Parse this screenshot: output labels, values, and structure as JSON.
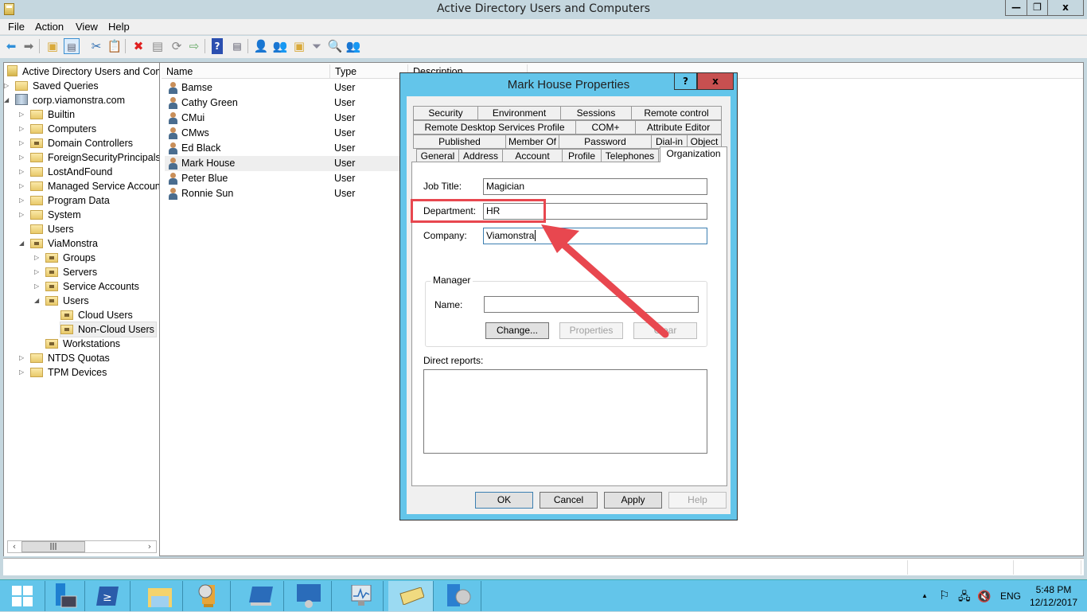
{
  "window": {
    "title": "Active Directory Users and Computers",
    "controls": {
      "minimize": "—",
      "restore": "❐",
      "close": "x"
    }
  },
  "menu": [
    "File",
    "Action",
    "View",
    "Help"
  ],
  "toolbar": {
    "buttons": [
      "back",
      "forward",
      "up-level",
      "show-hide-console-tree",
      "cut",
      "copy",
      "delete",
      "properties",
      "refresh",
      "export-list",
      "help",
      "show-action-pane",
      "new-user",
      "new-group",
      "new-ou",
      "filter",
      "find",
      "add-to-group"
    ]
  },
  "tree": {
    "root": "Active Directory Users and Com",
    "items": [
      {
        "label": "Saved Queries",
        "level": 1,
        "expander": "collapsed",
        "icon": "folder"
      },
      {
        "label": "corp.viamonstra.com",
        "level": 1,
        "expander": "expanded",
        "icon": "domain"
      },
      {
        "label": "Builtin",
        "level": 2,
        "expander": "collapsed",
        "icon": "folder"
      },
      {
        "label": "Computers",
        "level": 2,
        "expander": "collapsed",
        "icon": "folder"
      },
      {
        "label": "Domain Controllers",
        "level": 2,
        "expander": "collapsed",
        "icon": "ou"
      },
      {
        "label": "ForeignSecurityPrincipals",
        "level": 2,
        "expander": "collapsed",
        "icon": "folder"
      },
      {
        "label": "LostAndFound",
        "level": 2,
        "expander": "collapsed",
        "icon": "folder"
      },
      {
        "label": "Managed Service Accounts",
        "level": 2,
        "expander": "collapsed",
        "icon": "folder"
      },
      {
        "label": "Program Data",
        "level": 2,
        "expander": "collapsed",
        "icon": "folder"
      },
      {
        "label": "System",
        "level": 2,
        "expander": "collapsed",
        "icon": "folder"
      },
      {
        "label": "Users",
        "level": 2,
        "expander": "none",
        "icon": "folder"
      },
      {
        "label": "ViaMonstra",
        "level": 2,
        "expander": "expanded",
        "icon": "ou"
      },
      {
        "label": "Groups",
        "level": 3,
        "expander": "collapsed",
        "icon": "ou"
      },
      {
        "label": "Servers",
        "level": 3,
        "expander": "collapsed",
        "icon": "ou"
      },
      {
        "label": "Service Accounts",
        "level": 3,
        "expander": "collapsed",
        "icon": "ou"
      },
      {
        "label": "Users",
        "level": 3,
        "expander": "expanded",
        "icon": "ou"
      },
      {
        "label": "Cloud Users",
        "level": 4,
        "expander": "none",
        "icon": "ou"
      },
      {
        "label": "Non-Cloud Users",
        "level": 4,
        "expander": "none",
        "icon": "ou",
        "selected": true
      },
      {
        "label": "Workstations",
        "level": 3,
        "expander": "none",
        "icon": "ou"
      },
      {
        "label": "NTDS Quotas",
        "level": 2,
        "expander": "collapsed",
        "icon": "folder"
      },
      {
        "label": "TPM Devices",
        "level": 2,
        "expander": "collapsed",
        "icon": "folder"
      }
    ]
  },
  "list": {
    "columns": [
      "Name",
      "Type",
      "Description"
    ],
    "rows": [
      {
        "name": "Bamse",
        "type": "User"
      },
      {
        "name": "Cathy Green",
        "type": "User"
      },
      {
        "name": "CMui",
        "type": "User"
      },
      {
        "name": "CMws",
        "type": "User"
      },
      {
        "name": "Ed Black",
        "type": "User"
      },
      {
        "name": "Mark House",
        "type": "User",
        "selected": true
      },
      {
        "name": "Peter Blue",
        "type": "User"
      },
      {
        "name": "Ronnie Sun",
        "type": "User"
      }
    ]
  },
  "dialog": {
    "title": "Mark House Properties",
    "help_btn": "?",
    "close_btn": "x",
    "tabs_row1": [
      "Security",
      "Environment",
      "Sessions",
      "Remote control"
    ],
    "tabs_row2": [
      "Remote Desktop Services Profile",
      "COM+",
      "Attribute Editor"
    ],
    "tabs_row3": [
      "Published Certificates",
      "Member Of",
      "Password Replication",
      "Dial-in",
      "Object"
    ],
    "tabs_row4": [
      "General",
      "Address",
      "Account",
      "Profile",
      "Telephones",
      "Organization"
    ],
    "active_tab": "Organization",
    "fields": {
      "job_title": {
        "label": "Job Title:",
        "value": "Magician"
      },
      "department": {
        "label": "Department:",
        "value": "HR"
      },
      "company": {
        "label": "Company:",
        "value": "Viamonstra"
      }
    },
    "manager": {
      "group_label": "Manager",
      "name_label": "Name:",
      "name_value": "",
      "change": "Change...",
      "properties": "Properties",
      "clear": "Clear"
    },
    "direct_reports_label": "Direct reports:",
    "buttons": {
      "ok": "OK",
      "cancel": "Cancel",
      "apply": "Apply",
      "help": "Help"
    }
  },
  "annotation": {
    "color": "#e8474f",
    "target": "Department field"
  },
  "taskbar": {
    "apps": [
      "start",
      "server-manager",
      "powershell",
      "file-explorer",
      "task-scheduler",
      "powershell-ise",
      "control-panel",
      "performance-monitor",
      "active-directory-users-and-computers",
      "configuration-manager"
    ],
    "active_app": "active-directory-users-and-computers",
    "language": "ENG",
    "time": "5:48 PM",
    "date": "12/12/2017"
  }
}
